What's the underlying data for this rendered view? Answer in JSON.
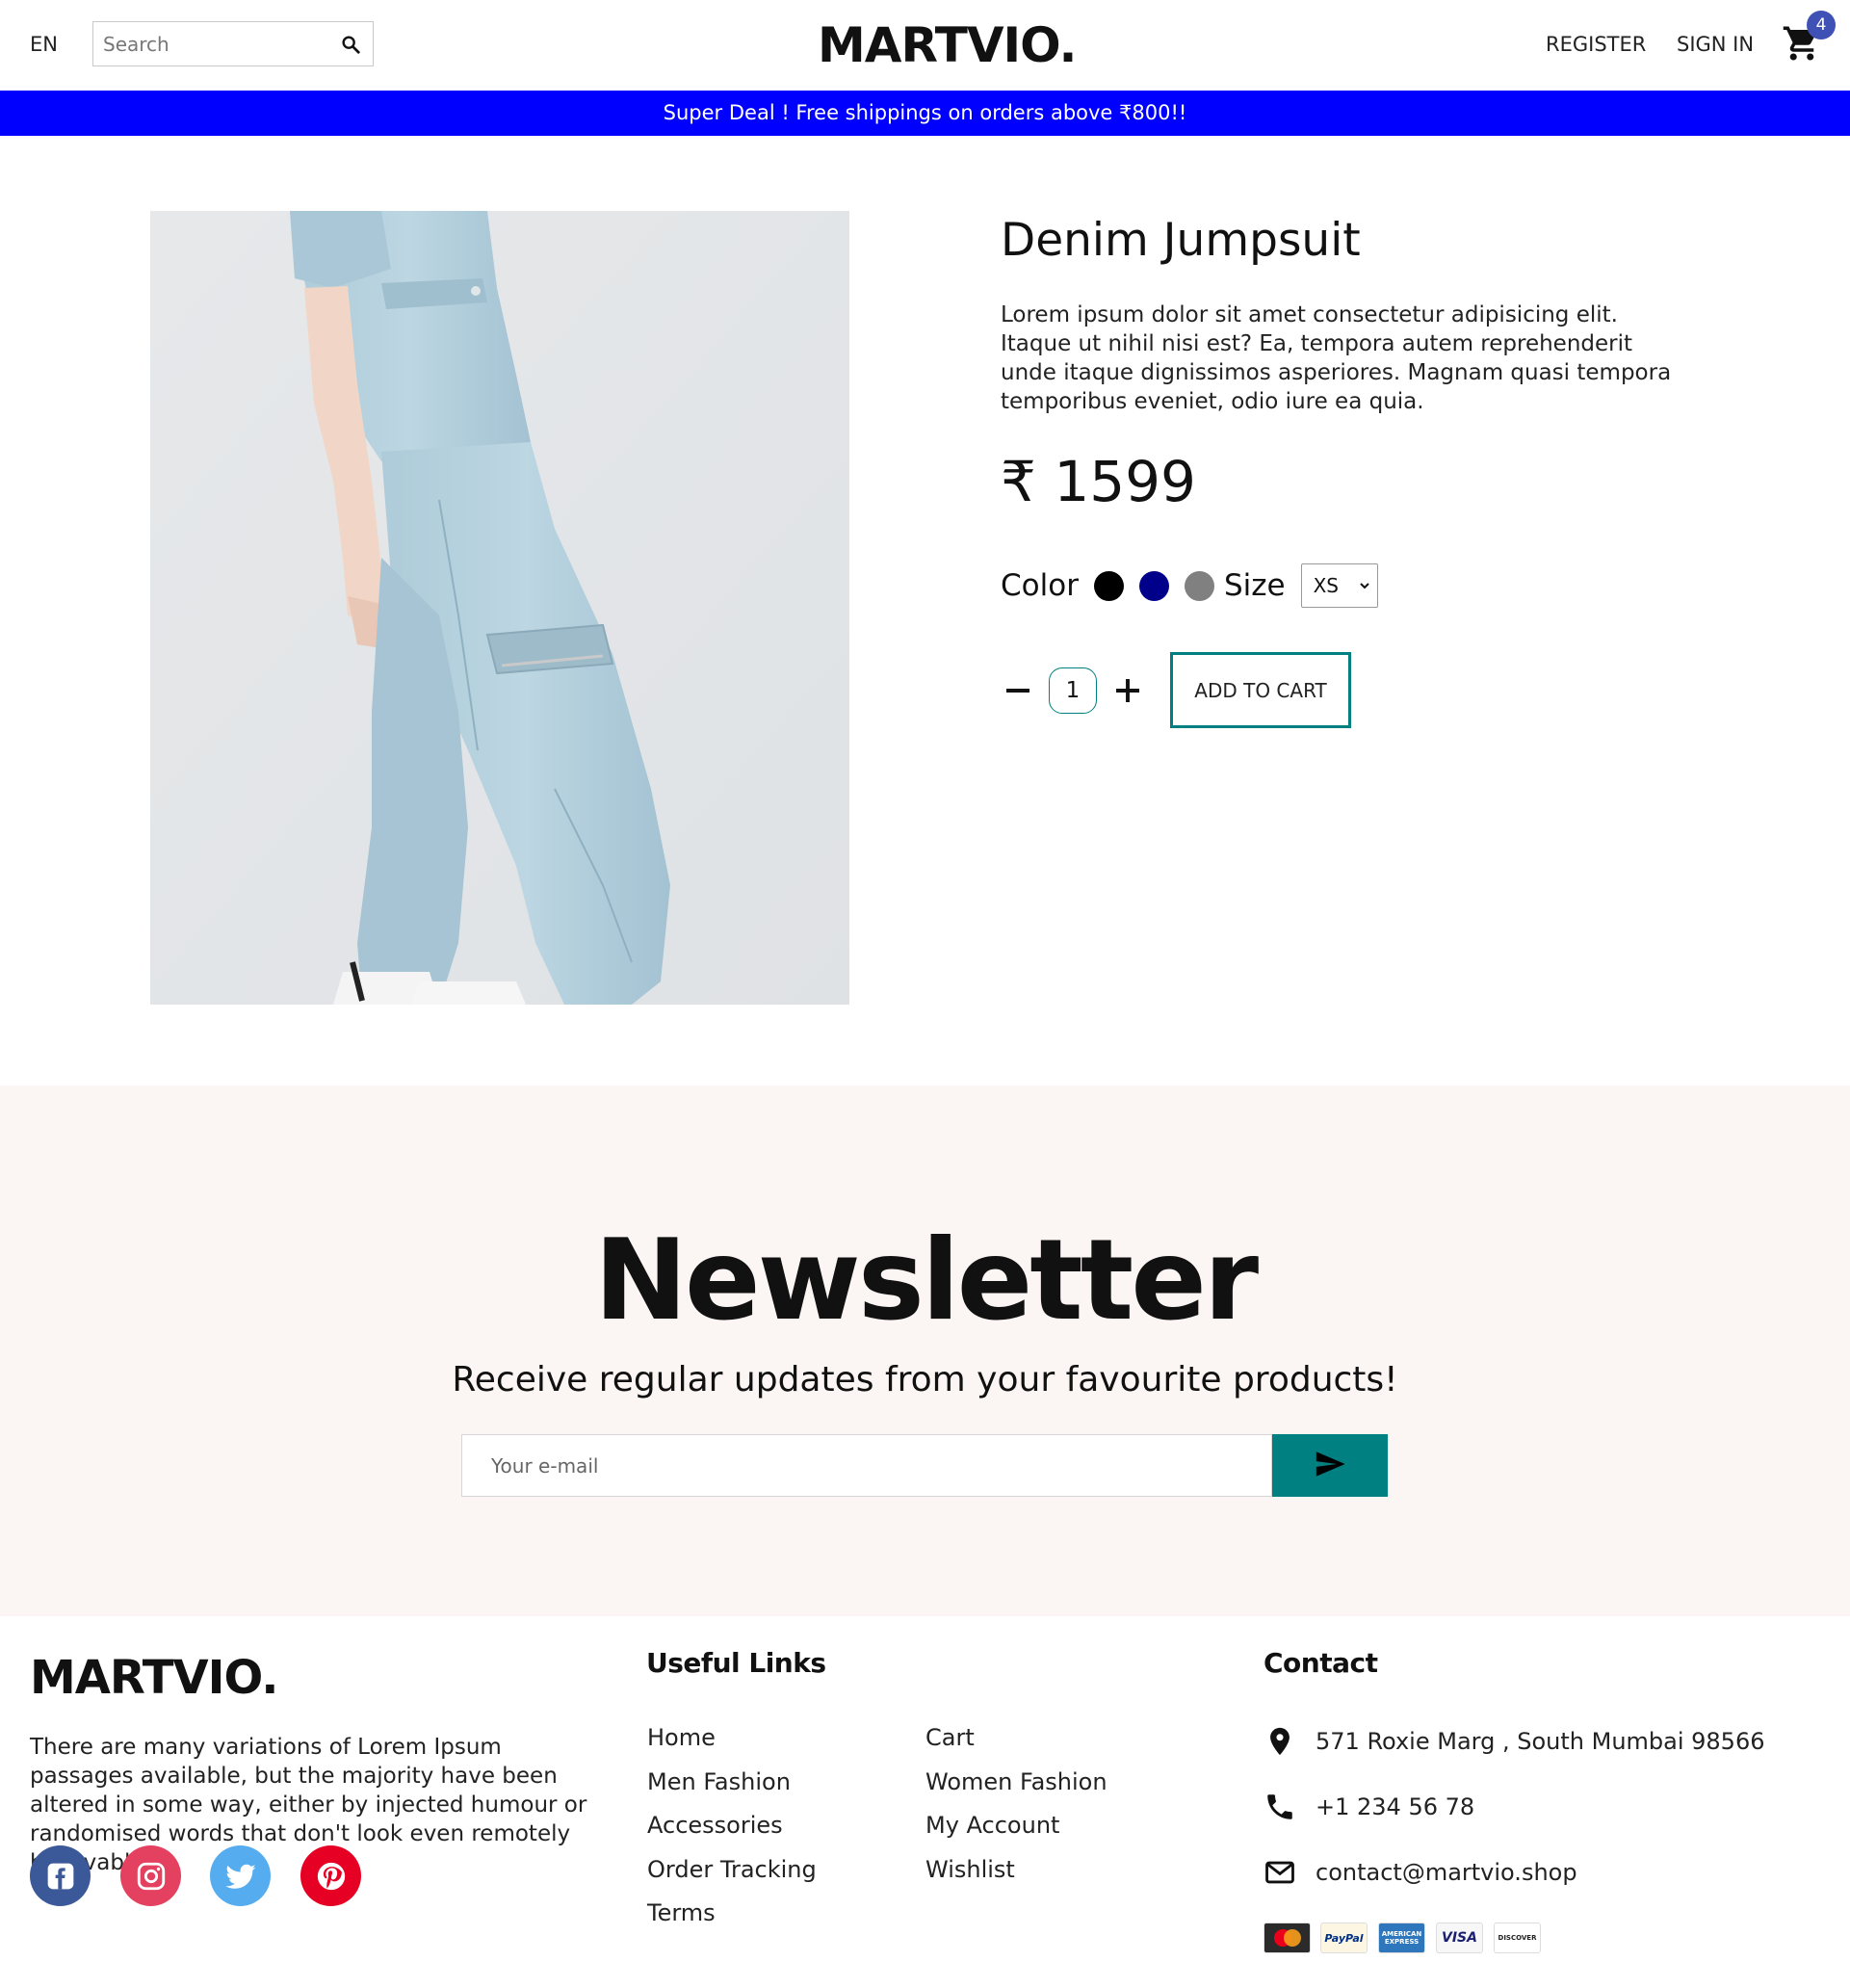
{
  "header": {
    "language": "EN",
    "search_placeholder": "Search",
    "logo": "MARTVIO.",
    "register": "REGISTER",
    "sign_in": "SIGN IN",
    "cart_count": "4"
  },
  "announcement": "Super Deal ! Free shippings on orders above ₹800!!",
  "product": {
    "title": "Denim Jumpsuit",
    "description": "Lorem ipsum dolor sit amet consectetur adipisicing elit. Itaque ut nihil nisi est? Ea, tempora autem reprehenderit unde itaque dignissimos asperiores. Magnam quasi tempora temporibus eveniet, odio iure ea quia.",
    "price": "₹ 1599",
    "color_label": "Color",
    "colors": [
      "#000000",
      "#00008b",
      "#808080"
    ],
    "size_label": "Size",
    "size_selected": "XS",
    "quantity": "1",
    "add_to_cart": "ADD TO CART"
  },
  "newsletter": {
    "title": "Newsletter",
    "subtitle": "Receive regular updates from your favourite products!",
    "email_placeholder": "Your e-mail"
  },
  "footer": {
    "logo": "MARTVIO.",
    "about": "There are many variations of Lorem Ipsum passages available, but the majority have been altered in some way, either by injected humour or randomised words that don't look even remotely believable.",
    "social": [
      {
        "icon": "facebook-icon",
        "color": "#3b5998"
      },
      {
        "icon": "instagram-icon",
        "color": "#e4405f"
      },
      {
        "icon": "twitter-icon",
        "color": "#55acee"
      },
      {
        "icon": "pinterest-icon",
        "color": "#e60023"
      }
    ],
    "useful_links_title": "Useful Links",
    "links_col1": [
      "Home",
      "Men Fashion",
      "Accessories",
      "Order Tracking",
      "Terms"
    ],
    "links_col2": [
      "Cart",
      "Women Fashion",
      "My Account",
      "Wishlist"
    ],
    "contact_title": "Contact",
    "address": "571 Roxie Marg , South Mumbai 98566",
    "phone": "+1 234 56 78",
    "email": "contact@martvio.shop",
    "payments": [
      "MasterCard",
      "PayPal",
      "AMERICAN EXPRESS",
      "VISA",
      "DISCOVER"
    ]
  },
  "colors": {
    "announcement_bg": "#0000ff",
    "accent": "#008080",
    "badge": "#3f51b5",
    "newsletter_bg": "#fbf5f3"
  }
}
